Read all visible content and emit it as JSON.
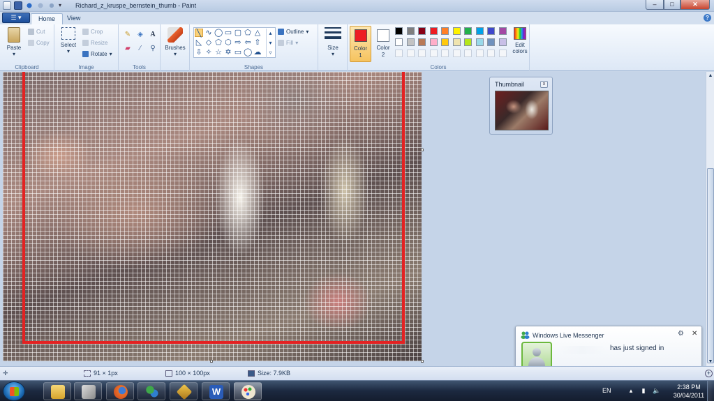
{
  "window": {
    "title": "Richard_z_kruspe_bernstein_thumb - Paint",
    "min_label": "–",
    "max_label": "□",
    "close_label": "✕"
  },
  "ribbon": {
    "app_button_label": "☰ ▾",
    "tabs": [
      {
        "label": "Home"
      },
      {
        "label": "View"
      }
    ],
    "help_label": "?",
    "clipboard": {
      "paste": "Paste",
      "cut": "Cut",
      "copy": "Copy",
      "label": "Clipboard"
    },
    "image": {
      "select": "Select",
      "crop": "Crop",
      "resize": "Resize",
      "rotate": "Rotate",
      "label": "Image"
    },
    "tools": {
      "label": "Tools",
      "text_glyph": "A"
    },
    "brushes": {
      "label": "Brushes"
    },
    "shapes": {
      "outline": "Outline",
      "fill": "Fill",
      "label": "Shapes"
    },
    "size": {
      "label": "Size"
    },
    "colors": {
      "color1_label": "Color",
      "color1_num": "1",
      "color2_label": "Color",
      "color2_num": "2",
      "edit_colors_line1": "Edit",
      "edit_colors_line2": "colors",
      "label": "Colors",
      "color1_value": "#ed1c24",
      "color2_value": "#ffffff",
      "palette_row1": [
        "#000000",
        "#7f7f7f",
        "#880015",
        "#ed1c24",
        "#ff7f27",
        "#fff200",
        "#22b14c",
        "#00a2e8",
        "#3f48cc",
        "#a349a4"
      ],
      "palette_row2": [
        "#ffffff",
        "#c3c3c3",
        "#b97a57",
        "#ffaec9",
        "#ffc90e",
        "#efe4b0",
        "#b5e61d",
        "#99d9ea",
        "#7092be",
        "#c8bfe7"
      ]
    }
  },
  "thumbnail": {
    "title": "Thumbnail",
    "close_label": "x"
  },
  "statusbar": {
    "cursor_pos": "91 × 1px",
    "image_size": "100 × 100px",
    "file_size": "Size: 7.9KB"
  },
  "messenger": {
    "title": "Windows Live Messenger",
    "message": "has just signed in",
    "gear_label": "⚙",
    "close_label": "✕"
  },
  "taskbar": {
    "lang": "EN",
    "time": "2:38 PM",
    "date": "30/04/2011"
  }
}
